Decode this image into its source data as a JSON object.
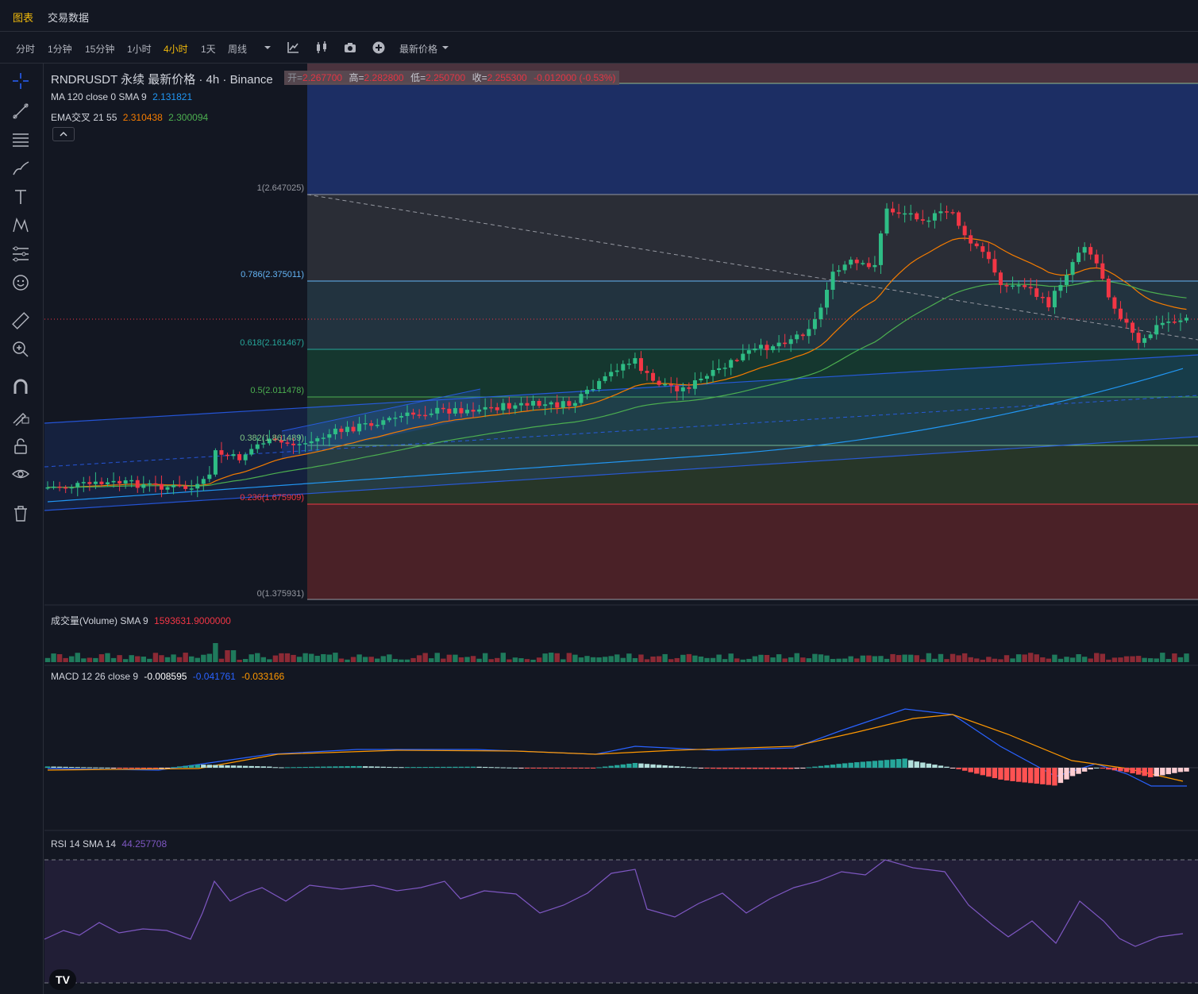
{
  "top_tabs": [
    {
      "label": "图表",
      "active": true
    },
    {
      "label": "交易数据",
      "active": false
    }
  ],
  "timeframes": [
    {
      "label": "分时",
      "active": false
    },
    {
      "label": "1分钟",
      "active": false
    },
    {
      "label": "15分钟",
      "active": false
    },
    {
      "label": "1小时",
      "active": false
    },
    {
      "label": "4小时",
      "active": true
    },
    {
      "label": "1天",
      "active": false
    },
    {
      "label": "周线",
      "active": false
    }
  ],
  "toolbar": {
    "price_type_label": "最新价格",
    "icons": [
      "chevron-down-icon",
      "indicator-icon",
      "candles-icon",
      "camera-icon",
      "plus-icon"
    ]
  },
  "left_tools": [
    "crosshair-icon",
    "trendline-icon",
    "hlines-icon",
    "brush-icon",
    "text-icon",
    "pattern-icon",
    "measure-lines-icon",
    "emoji-icon",
    "ruler-icon",
    "zoom-icon",
    "magnet-icon",
    "lock-draw-icon",
    "unlock-icon",
    "eye-icon",
    "trash-icon"
  ],
  "legend": {
    "symbol": "RNDRUSDT 永续 最新价格 · 4h · Binance",
    "ohlc": {
      "open_label": "开=",
      "open": "2.267700",
      "high_label": "高=",
      "high": "2.282800",
      "low_label": "低=",
      "low": "2.250700",
      "close_label": "收=",
      "close": "2.255300",
      "change": "-0.012000 (-0.53%)"
    },
    "ma": {
      "label": "MA 120 close 0 SMA 9",
      "value": "2.131821"
    },
    "ema": {
      "label": "EMA交叉 21 55",
      "value1": "2.310438",
      "value2": "2.300094"
    }
  },
  "fib_levels": [
    {
      "label": "1(2.647025)",
      "color": "#9598a1"
    },
    {
      "label": "0.786(2.375011)",
      "color": "#64b5f6"
    },
    {
      "label": "0.618(2.161467)",
      "color": "#26a69a"
    },
    {
      "label": "0.5(2.011478)",
      "color": "#4caf50"
    },
    {
      "label": "0.382(1.861489)",
      "color": "#81c784"
    },
    {
      "label": "0.236(1.675909)",
      "color": "#f23645"
    },
    {
      "label": "0(1.375931)",
      "color": "#9598a1"
    }
  ],
  "volume": {
    "label": "成交量(Volume) SMA 9",
    "value": "1593631.9000000"
  },
  "macd": {
    "label": "MACD 12 26 close 9",
    "v1": "-0.008595",
    "v2": "-0.041761",
    "v3": "-0.033166"
  },
  "rsi": {
    "label": "RSI 14 SMA 14",
    "value": "44.257708"
  },
  "colors": {
    "up": "#26a69a",
    "up_bright": "#2ebd85",
    "down": "#f23645",
    "accent": "#f0b90b",
    "ema_fast": "#f57c00",
    "ema_slow": "#4caf50",
    "ma": "#2196f3",
    "rsi": "#7e57c2",
    "macd": "#2962ff",
    "signal": "#ff9800"
  },
  "logo_text": "TV"
}
